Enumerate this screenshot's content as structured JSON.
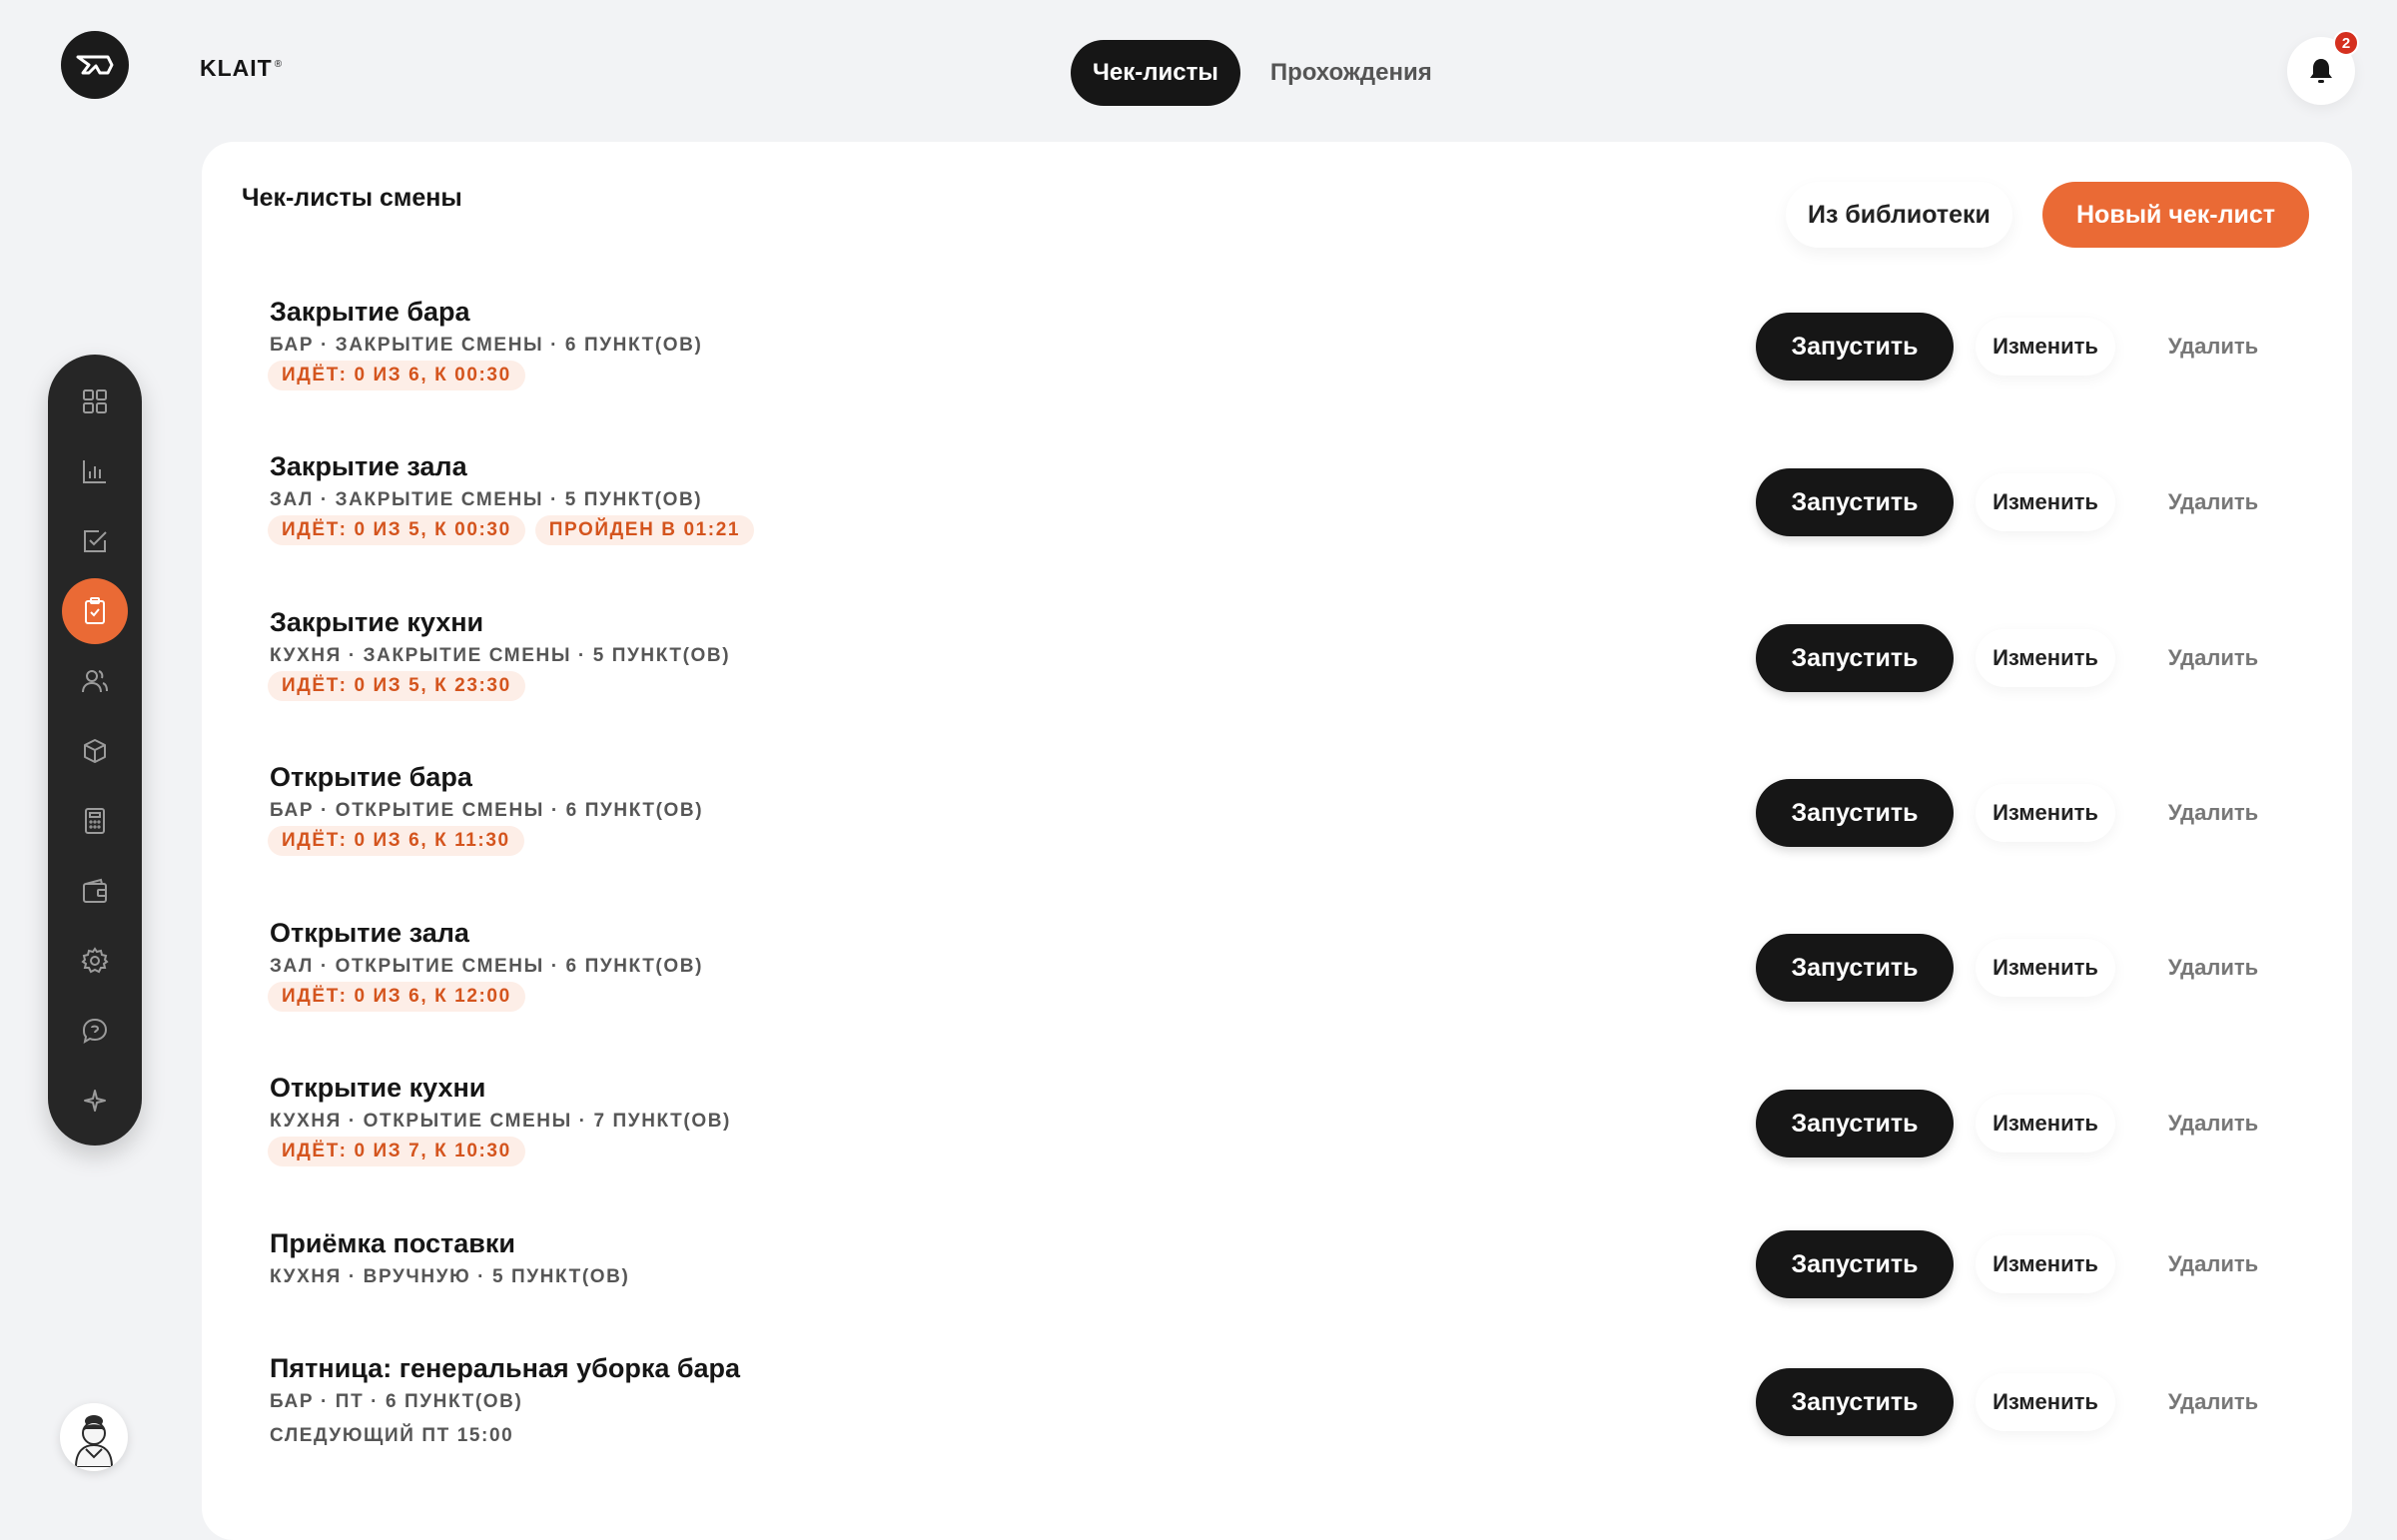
{
  "brand": {
    "name": "KLAIT",
    "mark": "®"
  },
  "top_tabs": [
    {
      "label": "Чек-листы",
      "active": true
    },
    {
      "label": "Прохождения",
      "active": false
    }
  ],
  "notifications": {
    "count": "2",
    "icon": "bell-icon"
  },
  "sidebar": {
    "items": [
      {
        "icon": "dashboard-icon",
        "active": false
      },
      {
        "icon": "bar-chart-icon",
        "active": false
      },
      {
        "icon": "checkbox-icon",
        "active": false
      },
      {
        "icon": "clipboard-check-icon",
        "active": true
      },
      {
        "icon": "users-icon",
        "active": false
      },
      {
        "icon": "box-icon",
        "active": false
      },
      {
        "icon": "calculator-icon",
        "active": false
      },
      {
        "icon": "wallet-icon",
        "active": false
      },
      {
        "icon": "gear-icon",
        "active": false
      },
      {
        "icon": "chat-icon",
        "active": false
      },
      {
        "icon": "sparkle-icon",
        "active": false
      }
    ],
    "active_color": "#ea6a35"
  },
  "main": {
    "title": "Чек-листы смены",
    "library_button": "Из библиотеки",
    "new_button": "Новый чек-лист",
    "accent_color": "#ea6a35",
    "row_actions": {
      "run": "Запустить",
      "edit": "Изменить",
      "delete": "Удалить"
    },
    "checklists": [
      {
        "title": "Закрытие бара",
        "meta": "БАР · ЗАКРЫТИЕ СМЕНЫ · 6 ПУНКТ(ОВ)",
        "badges": [
          "ИДЁТ: 0 ИЗ 6, К 00:30"
        ]
      },
      {
        "title": "Закрытие зала",
        "meta": "ЗАЛ · ЗАКРЫТИЕ СМЕНЫ · 5 ПУНКТ(ОВ)",
        "badges": [
          "ИДЁТ: 0 ИЗ 5, К 00:30",
          "ПРОЙДЕН В 01:21"
        ]
      },
      {
        "title": "Закрытие кухни",
        "meta": "КУХНЯ · ЗАКРЫТИЕ СМЕНЫ · 5 ПУНКТ(ОВ)",
        "badges": [
          "ИДЁТ: 0 ИЗ 5, К 23:30"
        ]
      },
      {
        "title": "Открытие бара",
        "meta": "БАР · ОТКРЫТИЕ СМЕНЫ · 6 ПУНКТ(ОВ)",
        "badges": [
          "ИДЁТ: 0 ИЗ 6, К 11:30"
        ]
      },
      {
        "title": "Открытие зала",
        "meta": "ЗАЛ · ОТКРЫТИЕ СМЕНЫ · 6 ПУНКТ(ОВ)",
        "badges": [
          "ИДЁТ: 0 ИЗ 6, К 12:00"
        ]
      },
      {
        "title": "Открытие кухни",
        "meta": "КУХНЯ · ОТКРЫТИЕ СМЕНЫ · 7 ПУНКТ(ОВ)",
        "badges": [
          "ИДЁТ: 0 ИЗ 7, К 10:30"
        ]
      },
      {
        "title": "Приёмка поставки",
        "meta": "КУХНЯ · ВРУЧНУЮ · 5 ПУНКТ(ОВ)",
        "badges": []
      },
      {
        "title": "Пятница: генеральная уборка бара",
        "meta": "БАР · ПТ · 6 ПУНКТ(ОВ)",
        "badges": [],
        "next": "СЛЕДУЮЩИЙ ПТ 15:00"
      }
    ]
  }
}
